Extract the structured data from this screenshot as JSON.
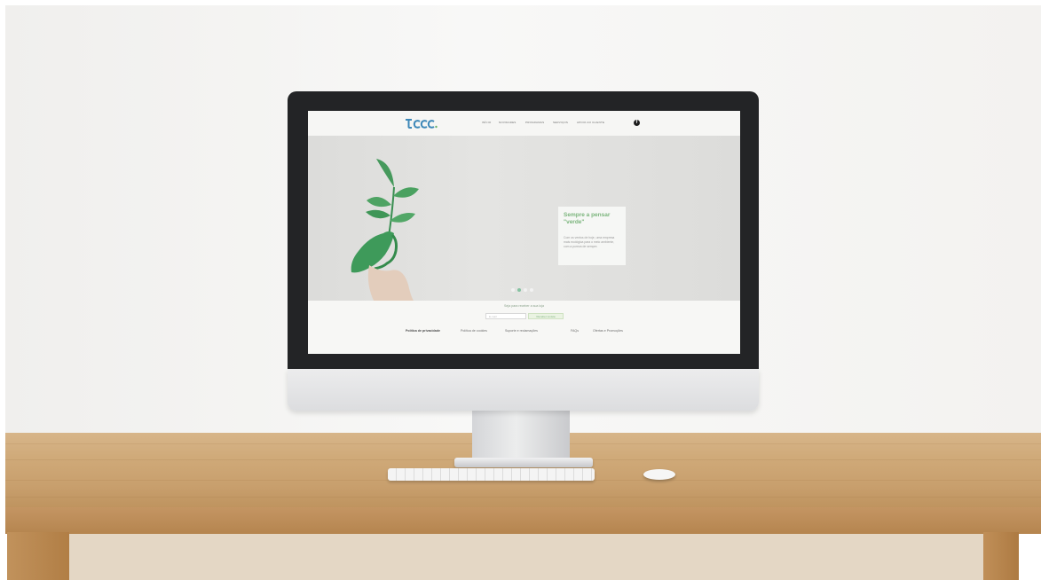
{
  "site": {
    "nav": {
      "items": [
        {
          "label": "INÍCIO"
        },
        {
          "label": "NOVIDADES"
        },
        {
          "label": "PROGRAMAS"
        },
        {
          "label": "SERVIÇOS"
        },
        {
          "label": "APOIO AO CLIENTE"
        }
      ],
      "social_icon": "facebook-icon"
    },
    "hero": {
      "title": "Sempre a pensar \"verde\"",
      "text": "Com os ventos de hoje, uma empresa mais ecológica para o meio ambiente, com a pureza de sempre.",
      "slides": 4,
      "active_slide": 2
    },
    "newsletter": {
      "label": "Seja para receber a sua loja",
      "placeholder": "E-mail",
      "button_label": "Receber revista"
    },
    "footer_links": [
      {
        "label": "Política de privacidade"
      },
      {
        "label": "Política de cookies"
      },
      {
        "label": "Suporte e reclamações"
      },
      {
        "label": "FAQs"
      },
      {
        "label": "Ofertas e Promoções"
      }
    ],
    "colors": {
      "accent_green": "#7bb57c",
      "leaf_green": "#3e9a5a",
      "logo_blue": "#3d88b8"
    }
  }
}
